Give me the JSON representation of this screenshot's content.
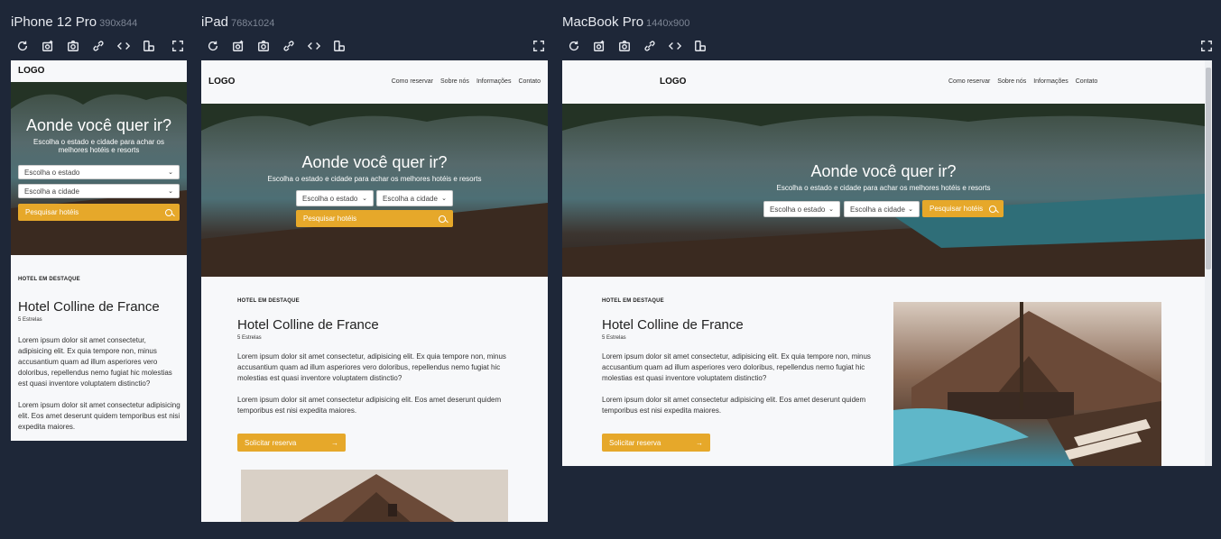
{
  "devices": [
    {
      "name": "iPhone 12 Pro",
      "size": "390x844"
    },
    {
      "name": "iPad",
      "size": "768x1024"
    },
    {
      "name": "MacBook Pro",
      "size": "1440x900"
    }
  ],
  "toolbar_icons": [
    "refresh-icon",
    "screenshot-add-icon",
    "camera-icon",
    "link-icon",
    "code-icon",
    "rotate-icon",
    "fullscreen-icon"
  ],
  "site": {
    "logo": "LOGO",
    "nav": [
      "Como reservar",
      "Sobre nós",
      "Informações",
      "Contato"
    ],
    "hero": {
      "title": "Aonde você quer ir?",
      "subtitle": "Escolha o estado e cidade para achar os melhores hotéis e resorts",
      "subtitle_mobile_1": "Escolha o estado e cidade para achar os",
      "subtitle_mobile_2": "melhores hotéis e resorts",
      "state_placeholder": "Escolha o estado",
      "city_placeholder": "Escolha a cidade",
      "search_label": "Pesquisar hotéis"
    },
    "featured": {
      "label": "HOTEL EM DESTAQUE",
      "name": "Hotel Colline de France",
      "stars": "5 Estrelas",
      "p1": "Lorem ipsum dolor sit amet consectetur, adipisicing elit. Ex quia tempore non, minus accusantium quam ad illum asperiores vero doloribus, repellendus nemo fugiat hic molestias est quasi inventore voluptatem distinctio?",
      "p2": "Lorem ipsum dolor sit amet consectetur adipisicing elit. Eos amet deserunt quidem temporibus est nisi expedita maiores.",
      "book_label": "Solicitar reserva"
    }
  },
  "colors": {
    "accent": "#e6a82a",
    "background": "#1e2738",
    "page": "#f7f8fa"
  }
}
